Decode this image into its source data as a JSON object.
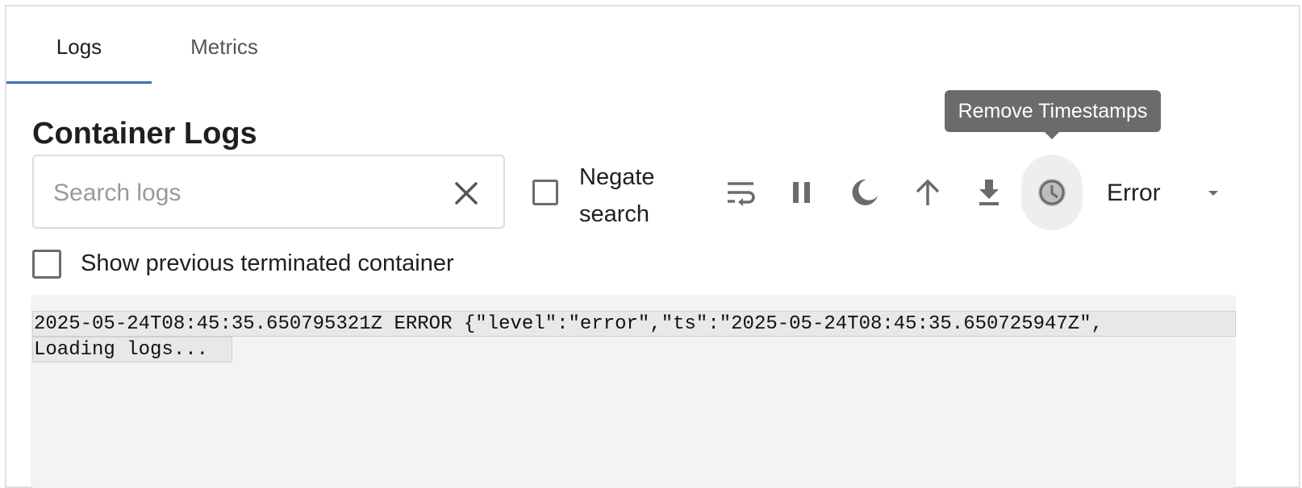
{
  "tabs": [
    {
      "label": "Logs",
      "active": true
    },
    {
      "label": "Metrics",
      "active": false
    }
  ],
  "page_title": "Container Logs",
  "search": {
    "placeholder": "Search logs",
    "value": ""
  },
  "negate": {
    "label": "Negate search",
    "checked": false
  },
  "toolbar": {
    "icons": [
      "wrap-lines-icon",
      "pause-icon",
      "dark-mode-icon",
      "arrow-up-icon",
      "download-icon",
      "clock-icon"
    ],
    "tooltip": "Remove Timestamps"
  },
  "level_filter": {
    "selected": "Error"
  },
  "previous_container": {
    "label": "Show previous terminated container",
    "checked": false
  },
  "logs": {
    "lines": [
      "2025-05-24T08:45:35.650795321Z ERROR {\"level\":\"error\",\"ts\":\"2025-05-24T08:45:35.650725947Z\",",
      "Loading logs..."
    ]
  },
  "colors": {
    "accent": "#3a73b4",
    "tooltip_bg": "#6b6b6b",
    "log_bg": "#f3f3f3"
  }
}
